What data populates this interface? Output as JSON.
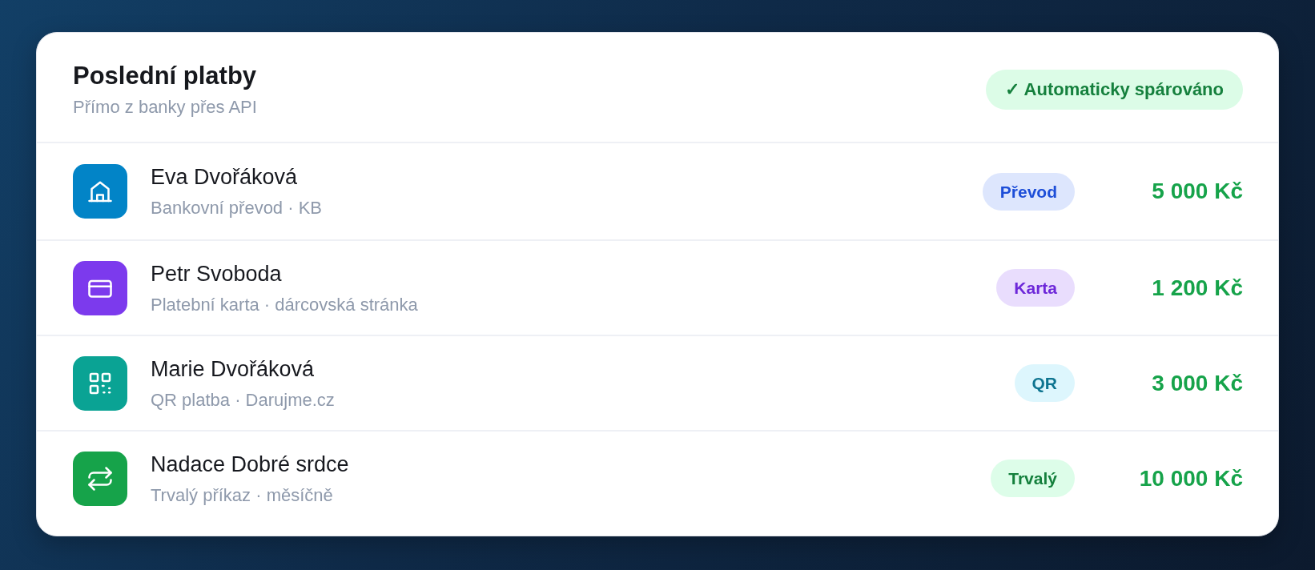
{
  "header": {
    "title": "Poslední platby",
    "subtitle": "Přímo z banky přes API",
    "status": "✓ Automaticky spárováno"
  },
  "payments": [
    {
      "kind": "bank",
      "color": "#0284c7",
      "name": "Eva Dvořáková",
      "detail": "Bankovní převod · KB",
      "tag": {
        "label": "Převod",
        "color": "#1d4ed8"
      },
      "amount": "5 000 Kč"
    },
    {
      "kind": "card",
      "color": "#7c3aed",
      "name": "Petr Svoboda",
      "detail": "Platební karta · dárcovská stránka",
      "tag": {
        "label": "Karta",
        "color": "#6d28d9"
      },
      "amount": "1 200 Kč"
    },
    {
      "kind": "qr",
      "color": "#0aa394",
      "name": "Marie Dvořáková",
      "detail": "QR platba · Darujme.cz",
      "tag": {
        "label": "QR",
        "color": "#0e7490"
      },
      "amount": "3 000 Kč"
    },
    {
      "kind": "repeat",
      "color": "#16a34a",
      "name": "Nadace Dobré srdce",
      "detail": "Trvalý příkaz · měsíčně",
      "tag": {
        "label": "Trvalý",
        "color": "#15803d"
      },
      "amount": "10 000 Kč"
    }
  ]
}
